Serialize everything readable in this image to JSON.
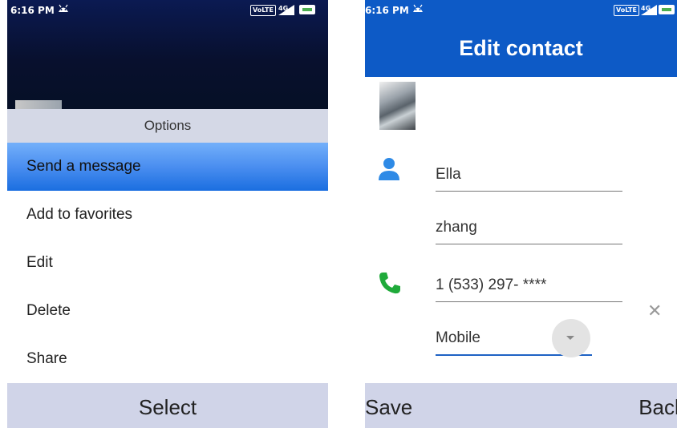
{
  "left_screen": {
    "status_bar": {
      "time": "6:16 PM",
      "network": "VoLTE",
      "signal": "4G"
    },
    "options": {
      "header": "Options",
      "items": [
        {
          "label": "Send a message",
          "selected": true
        },
        {
          "label": "Add to favorites",
          "selected": false
        },
        {
          "label": "Edit",
          "selected": false
        },
        {
          "label": "Delete",
          "selected": false
        },
        {
          "label": "Share",
          "selected": false
        }
      ]
    },
    "softkey": {
      "center": "Select"
    }
  },
  "right_screen": {
    "status_bar": {
      "time": "6:16 PM",
      "network": "VoLTE",
      "signal": "4G"
    },
    "title": "Edit contact",
    "fields": {
      "first_name": "Ella",
      "last_name": "zhang",
      "phone": "1 (533) 297- ****",
      "phone_type": "Mobile"
    },
    "softkeys": {
      "left": "Save",
      "right": "Back"
    }
  },
  "colors": {
    "header_blue": "#0d5ac6",
    "selected_item": "#4a8ef0",
    "softbar": "#d0d4e8",
    "person_icon": "#2e8ae6",
    "phone_icon": "#1faa3a"
  }
}
